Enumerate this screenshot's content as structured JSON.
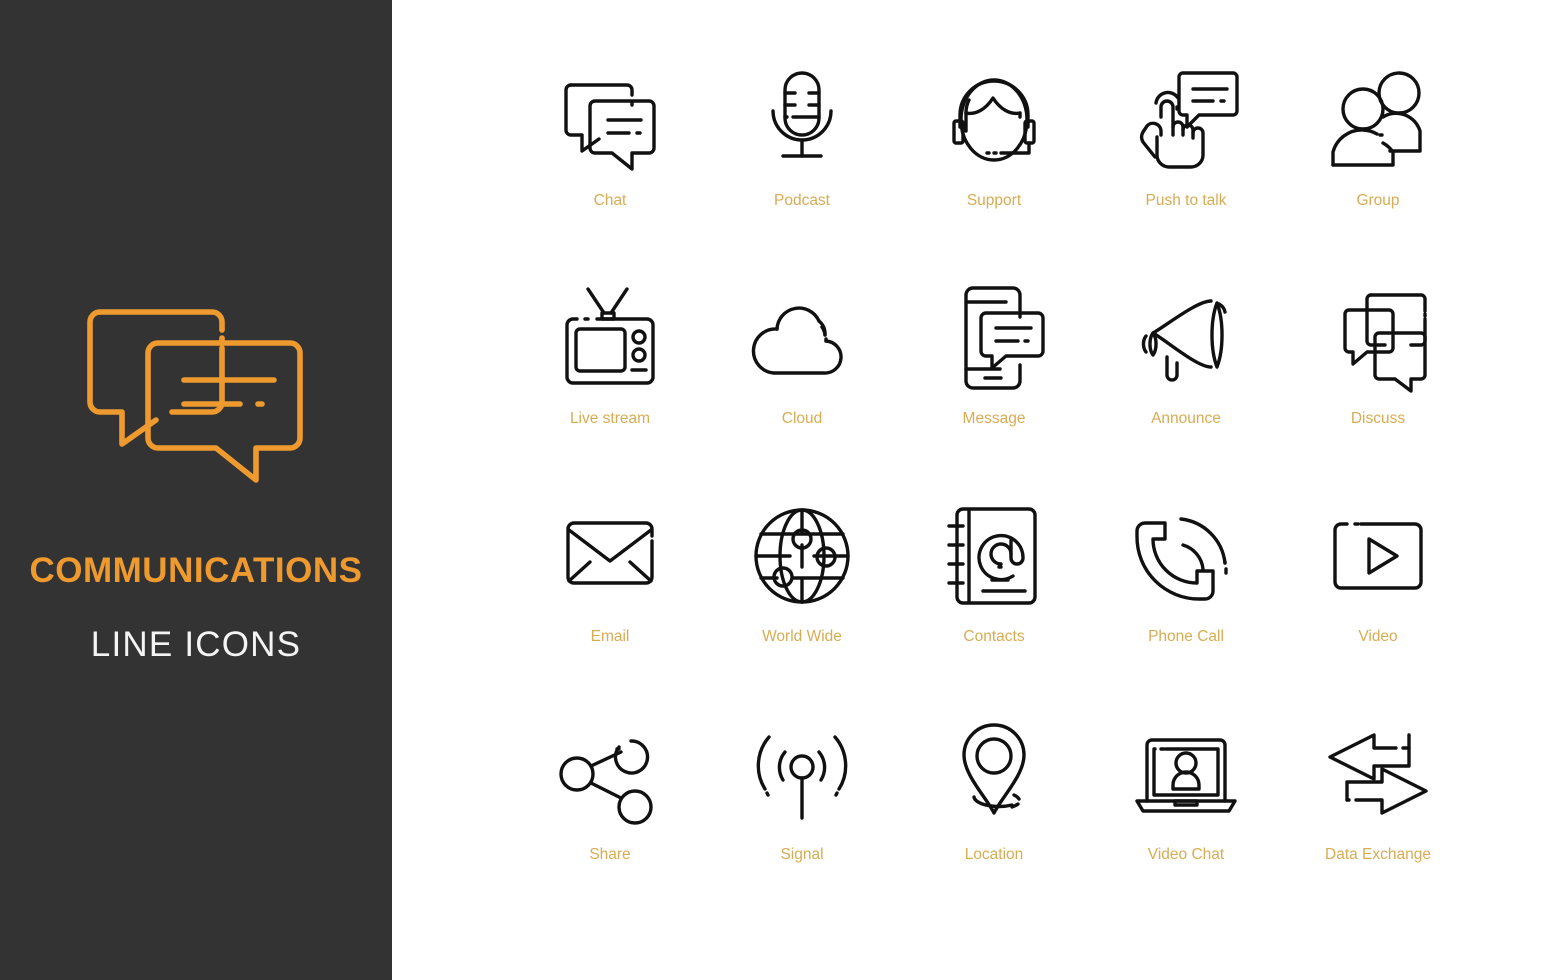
{
  "sidebar": {
    "title": "COMMUNICATIONS",
    "subtitle": "LINE ICONS",
    "logo_icon": "chat-bubbles-icon",
    "background_color": "#333333",
    "accent_color": "#EE9A2E",
    "subtitle_color": "#F4F4F4"
  },
  "main": {
    "background_color": "#FFFFFF",
    "label_color": "#D8AC53",
    "icon_stroke_color": "#111111",
    "columns": 5,
    "rows": 4,
    "icons": [
      {
        "label": "Chat",
        "icon": "chat-bubbles-icon"
      },
      {
        "label": "Podcast",
        "icon": "microphone-icon"
      },
      {
        "label": "Support",
        "icon": "headset-operator-icon"
      },
      {
        "label": "Push to talk",
        "icon": "hand-press-bubble-icon"
      },
      {
        "label": "Group",
        "icon": "two-users-icon"
      },
      {
        "label": "Live stream",
        "icon": "retro-television-icon"
      },
      {
        "label": "Cloud",
        "icon": "cloud-icon"
      },
      {
        "label": "Message",
        "icon": "smartphone-message-icon"
      },
      {
        "label": "Announce",
        "icon": "megaphone-icon"
      },
      {
        "label": "Discuss",
        "icon": "three-bubbles-icon"
      },
      {
        "label": "Email",
        "icon": "envelope-icon"
      },
      {
        "label": "World Wide",
        "icon": "globe-network-icon"
      },
      {
        "label": "Contacts",
        "icon": "address-book-at-icon"
      },
      {
        "label": "Phone Call",
        "icon": "phone-handset-icon"
      },
      {
        "label": "Video",
        "icon": "video-play-icon"
      },
      {
        "label": "Share",
        "icon": "share-nodes-icon"
      },
      {
        "label": "Signal",
        "icon": "antenna-signal-icon"
      },
      {
        "label": "Location",
        "icon": "map-pin-icon"
      },
      {
        "label": "Video Chat",
        "icon": "laptop-person-icon"
      },
      {
        "label": "Data Exchange",
        "icon": "two-arrows-exchange-icon"
      }
    ]
  }
}
